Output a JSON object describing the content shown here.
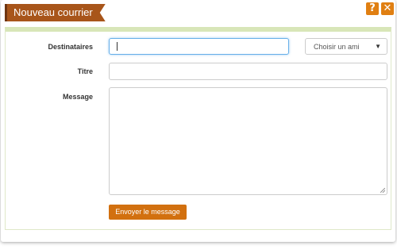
{
  "dialog": {
    "title": "Nouveau courrier",
    "help_glyph": "?",
    "close_glyph": "✕"
  },
  "form": {
    "recipients_label": "Destinataires",
    "recipients_value": "",
    "friend_select": {
      "selected": "Choisir un ami",
      "arrow": "▼"
    },
    "title_label": "Titre",
    "title_value": "",
    "message_label": "Message",
    "message_value": "",
    "send_button": "Envoyer le message"
  },
  "colors": {
    "ribbon": "#a8551a",
    "header_buttons": "#e07f12",
    "send_button": "#d2700f",
    "panel_top_border": "#d8e6b8",
    "focus_border": "#66afe9"
  },
  "icons": {
    "help": "help-icon",
    "close": "close-icon",
    "dropdown": "chevron-down-icon"
  }
}
